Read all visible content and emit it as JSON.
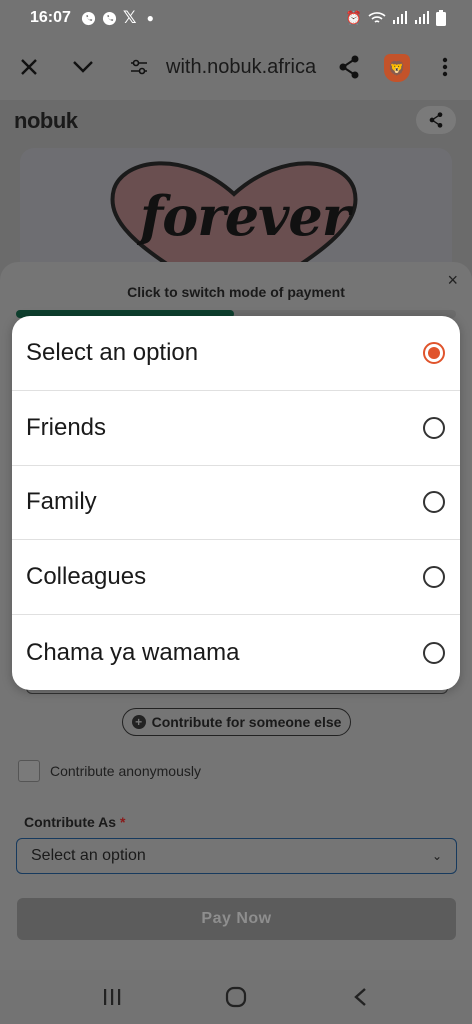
{
  "status_bar": {
    "time": "16:07",
    "left_icons": [
      "whatsapp-icon",
      "whatsapp-business-icon",
      "x-icon",
      "dot-icon"
    ],
    "right_icons": [
      "alarm-icon",
      "wifi-icon",
      "signal-icon",
      "signal-icon",
      "battery-icon"
    ]
  },
  "browser": {
    "url": "with.nobuk.africa"
  },
  "site": {
    "logo": "nobuk",
    "banner_text": "forever"
  },
  "sheet": {
    "close": "×",
    "title": "Click to switch mode of payment",
    "someone_else_label": "Contribute for someone else",
    "anonymous_label": "Contribute anonymously",
    "contribute_as_label": "Contribute As",
    "required_mark": "*",
    "select_value": "Select an option",
    "pay_button": "Pay Now"
  },
  "dialog": {
    "options": [
      {
        "label": "Select an option",
        "selected": true
      },
      {
        "label": "Friends",
        "selected": false
      },
      {
        "label": "Family",
        "selected": false
      },
      {
        "label": "Colleagues",
        "selected": false
      },
      {
        "label": "Chama ya wamama",
        "selected": false
      }
    ]
  },
  "colors": {
    "accent": "#e0542c",
    "toggle_active": "#0e3f2e"
  }
}
